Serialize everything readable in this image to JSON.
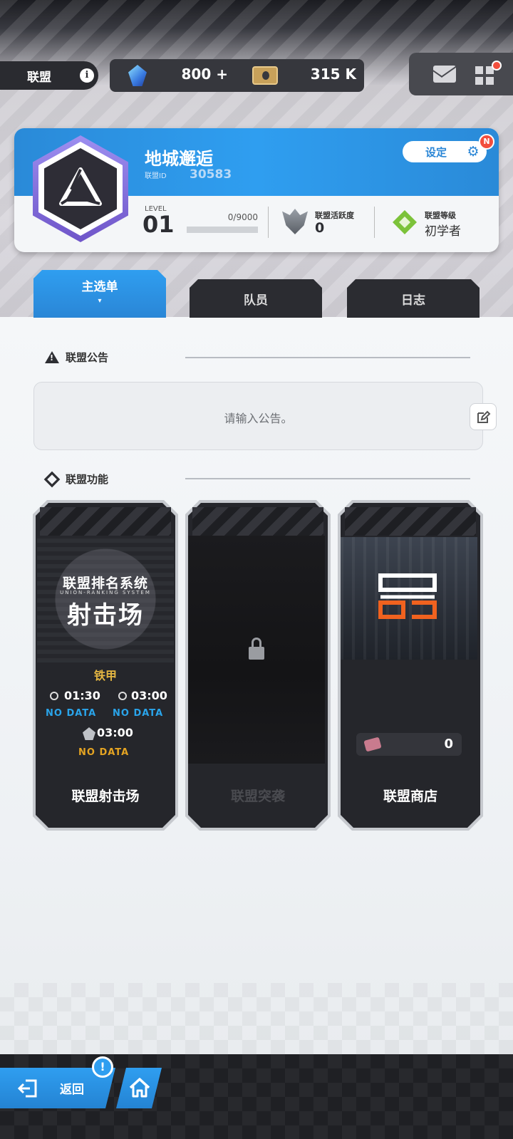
{
  "header": {
    "union_tab_label": "联盟",
    "info_icon": "info-icon",
    "gems": "800",
    "gems_plus": "+",
    "credits": "315 K"
  },
  "union": {
    "name": "地城邂逅",
    "id_label": "联盟ID",
    "id_value": "30583",
    "settings_label": "设定",
    "new_badge": "N",
    "level_label": "LEVEL",
    "level_value": "01",
    "exp_text": "0/9000",
    "exp_progress": 0,
    "activity_label": "联盟活跃度",
    "activity_value": "0",
    "rank_label": "联盟等级",
    "rank_value": "初学者",
    "accent_color": "#2f9ef0"
  },
  "tabs": [
    {
      "label": "主选单",
      "caret": "▾",
      "selected": true
    },
    {
      "label": "队员",
      "selected": false
    },
    {
      "label": "日志",
      "selected": false
    }
  ],
  "announcement": {
    "title": "联盟公告",
    "placeholder": "请输入公告。"
  },
  "features": {
    "title": "联盟功能",
    "cards": [
      {
        "label": "联盟射击场",
        "art_title1": "联盟排名系统",
        "art_subtitle": "UNION-RANKING SYSTEM",
        "art_title2": "射击场",
        "grade": "铁甲",
        "time1": "01:30",
        "time2": "03:00",
        "time3": "03:00",
        "nodata": "NO DATA"
      },
      {
        "label": "联盟突袭",
        "locked": true
      },
      {
        "label": "联盟商店",
        "coin_value": "0"
      }
    ]
  },
  "bottom_nav": {
    "back_label": "返回",
    "alert_badge": "!"
  }
}
